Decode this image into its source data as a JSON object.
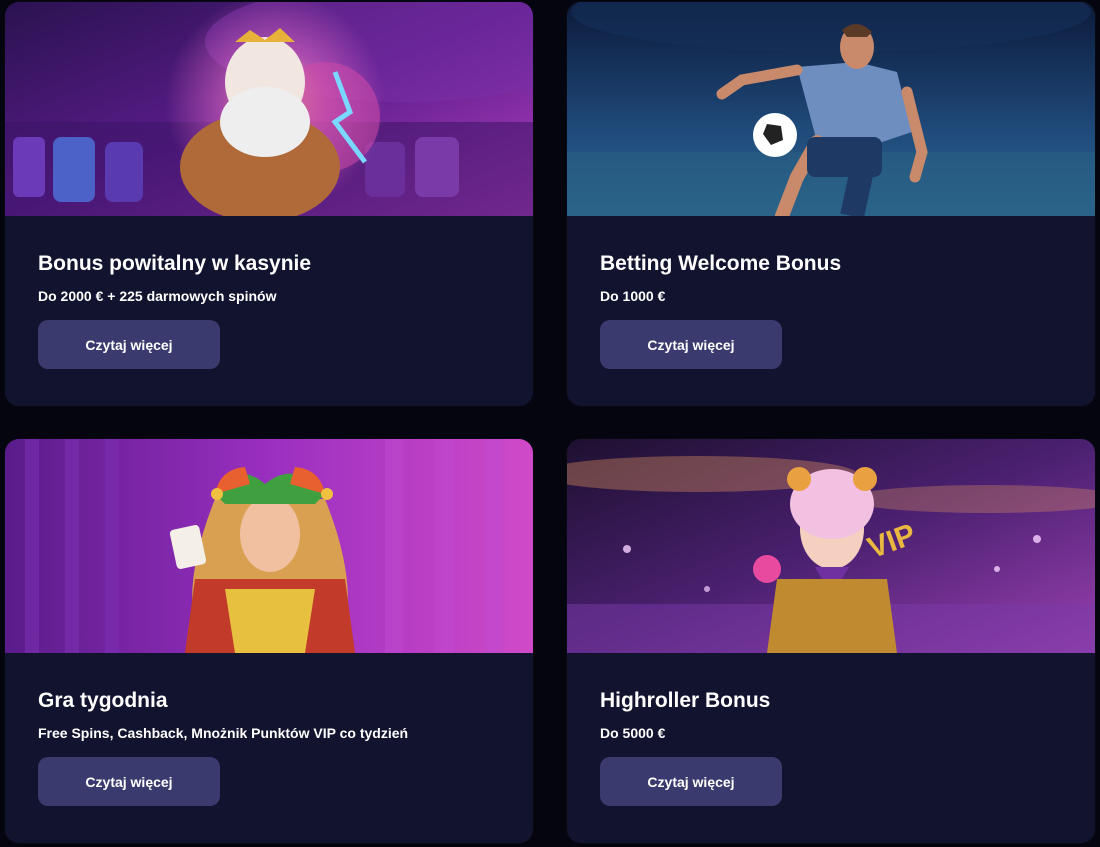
{
  "colors": {
    "page_background": "#050510",
    "card_background": "#12132e",
    "button_background": "#3a3a6e",
    "text": "#ffffff"
  },
  "cards": [
    {
      "title": "Bonus powitalny w kasynie",
      "subtitle": "Do 2000 € + 225 darmowych spinów",
      "button_label": "Czytaj więcej",
      "image": "zeus-casino-banner"
    },
    {
      "title": "Betting Welcome Bonus",
      "subtitle": "Do 1000 €",
      "button_label": "Czytaj więcej",
      "image": "football-player-banner"
    },
    {
      "title": "Gra tygodnia",
      "subtitle": "Free Spins, Cashback, Mnożnik Punktów VIP co tydzień",
      "button_label": "Czytaj więcej",
      "image": "jester-woman-banner"
    },
    {
      "title": "Highroller Bonus",
      "subtitle": "Do 5000 €",
      "button_label": "Czytaj więcej",
      "image": "vip-woman-banner"
    }
  ]
}
